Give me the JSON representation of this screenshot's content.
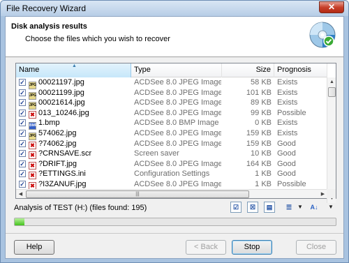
{
  "window": {
    "title": "File Recovery Wizard",
    "close_glyph": "✕"
  },
  "header": {
    "title": "Disk analysis results",
    "subtitle": "Choose the files which you wish to recover",
    "icon": "disc-icon"
  },
  "table": {
    "columns": {
      "name": "Name",
      "type": "Type",
      "size": "Size",
      "prognosis": "Prognosis"
    },
    "rows": [
      {
        "name": "00021197.jpg",
        "type": "ACDSee 8.0 JPEG Image",
        "size": "58 KB",
        "prognosis": "Exists",
        "icon": "jpg"
      },
      {
        "name": "00021199.jpg",
        "type": "ACDSee 8.0 JPEG Image",
        "size": "101 KB",
        "prognosis": "Exists",
        "icon": "jpg"
      },
      {
        "name": "00021614.jpg",
        "type": "ACDSee 8.0 JPEG Image",
        "size": "89 KB",
        "prognosis": "Exists",
        "icon": "jpg"
      },
      {
        "name": "013_10246.jpg",
        "type": "ACDSee 8.0 JPEG Image",
        "size": "99 KB",
        "prognosis": "Possible",
        "icon": "bad"
      },
      {
        "name": "1.bmp",
        "type": "ACDSee 8.0 BMP Image",
        "size": "0 KB",
        "prognosis": "Exists",
        "icon": "bmp"
      },
      {
        "name": "574062.jpg",
        "type": "ACDSee 8.0 JPEG Image",
        "size": "159 KB",
        "prognosis": "Exists",
        "icon": "jpg"
      },
      {
        "name": "?74062.jpg",
        "type": "ACDSee 8.0 JPEG Image",
        "size": "159 KB",
        "prognosis": "Good",
        "icon": "bad"
      },
      {
        "name": "?CRNSAVE.scr",
        "type": "Screen saver",
        "size": "10 KB",
        "prognosis": "Good",
        "icon": "bad"
      },
      {
        "name": "?DRIFT.jpg",
        "type": "ACDSee 8.0 JPEG Image",
        "size": "164 KB",
        "prognosis": "Good",
        "icon": "bad"
      },
      {
        "name": "?ETTINGS.ini",
        "type": "Configuration Settings",
        "size": "1 KB",
        "prognosis": "Good",
        "icon": "bad"
      },
      {
        "name": "?I3ZANUF.jpg",
        "type": "ACDSee 8.0 JPEG Image",
        "size": "1 KB",
        "prognosis": "Possible",
        "icon": "bad"
      }
    ]
  },
  "status": {
    "text": "Analysis of TEST (H:) (files found: 195)"
  },
  "progress": {
    "fraction": 0.03
  },
  "buttons": {
    "help": "Help",
    "back": "< Back",
    "stop": "Stop",
    "close": "Close"
  }
}
